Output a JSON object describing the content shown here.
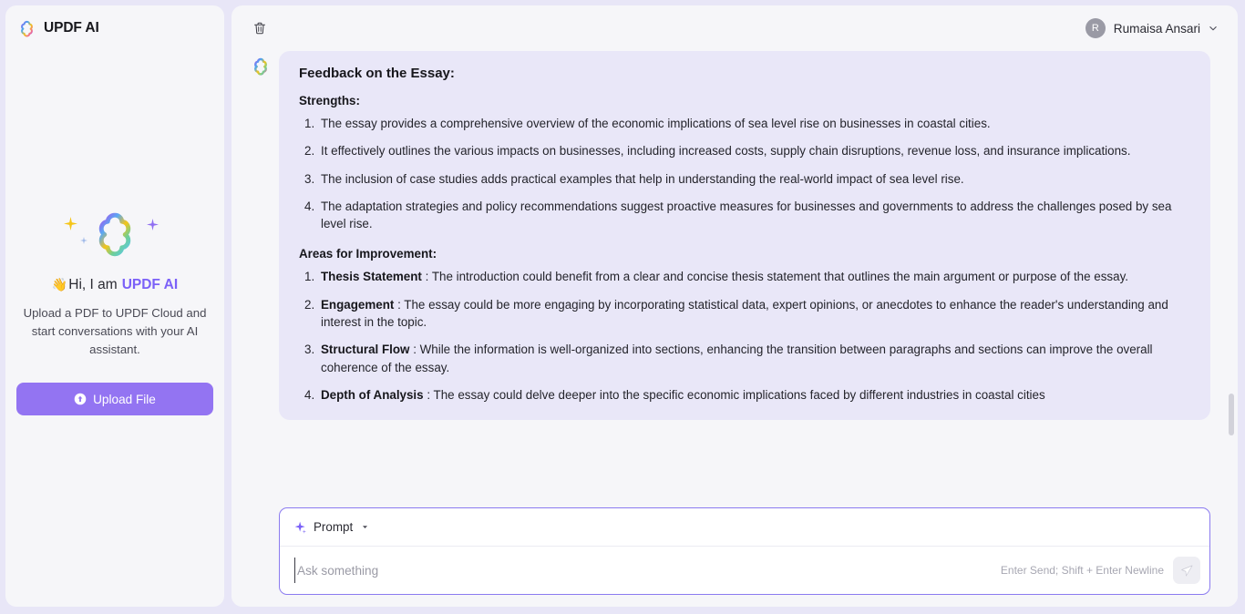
{
  "sidebar": {
    "brand": "UPDF AI",
    "brand_icon": "clover-logo-icon",
    "greeting_wave": "👋",
    "greeting_prefix": "Hi, I am",
    "greeting_brand": "UPDF AI",
    "description": "Upload a PDF to UPDF Cloud and start conversations with your AI assistant.",
    "upload_button": "Upload File",
    "upload_icon": "upload-circle-icon"
  },
  "topbar": {
    "delete_icon": "trash-icon",
    "user_initial": "R",
    "user_name": "Rumaisa Ansari",
    "caret_icon": "chevron-down-icon"
  },
  "message": {
    "avatar_icon": "ai-clover-avatar-icon",
    "title": "Feedback on the Essay:",
    "strengths_heading": "Strengths:",
    "strengths": [
      "The essay provides a comprehensive overview of the economic implications of sea level rise on businesses in coastal cities.",
      "It effectively outlines the various impacts on businesses, including increased costs, supply chain disruptions, revenue loss, and insurance implications.",
      "The inclusion of case studies adds practical examples that help in understanding the real-world impact of sea level rise.",
      "The adaptation strategies and policy recommendations suggest proactive measures for businesses and governments to address the challenges posed by sea level rise."
    ],
    "improvements_heading": "Areas for Improvement:",
    "improvements": [
      {
        "label": "Thesis Statement",
        "separator": " : ",
        "text": "The introduction could benefit from a clear and concise thesis statement that outlines the main argument or purpose of the essay."
      },
      {
        "label": "Engagement",
        "separator": " : ",
        "text": "The essay could be more engaging by incorporating statistical data, expert opinions, or anecdotes to enhance the reader's understanding and interest in the topic."
      },
      {
        "label": "Structural Flow",
        "separator": " : ",
        "text": "While the information is well-organized into sections, enhancing the transition between paragraphs and sections can improve the overall coherence of the essay."
      },
      {
        "label": "Depth of Analysis",
        "separator": " : ",
        "text": "The essay could delve deeper into the specific economic implications faced by different industries in coastal cities"
      }
    ]
  },
  "composer": {
    "prompt_label": "Prompt",
    "prompt_icon": "sparkle-icon",
    "prompt_caret_icon": "caret-down-icon",
    "input_value": "",
    "input_placeholder": "Ask something",
    "send_hint": "Enter Send; Shift + Enter Newline",
    "send_icon": "send-paper-plane-icon"
  },
  "colors": {
    "page_background": "#e8e6f7",
    "panel": "#f6f6f9",
    "bubble": "#e9e7f8",
    "accent_purple": "#7b61f8",
    "upload_button": "#9374f2",
    "composer_border": "#8b7bf0"
  }
}
